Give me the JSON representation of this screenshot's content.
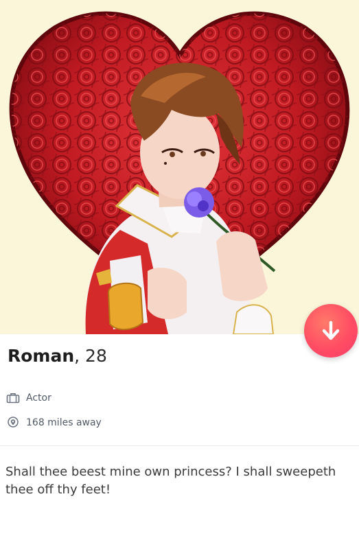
{
  "profile": {
    "name": "Roman",
    "age_text": ", 28",
    "job": "Actor",
    "distance": "168 miles away",
    "bio": "Shall thee beest mine own princess? I shall sweepeth thee off thy feet!"
  },
  "icons": {
    "down": "arrow-down-icon",
    "job": "briefcase-icon",
    "distance": "location-pin-icon"
  },
  "colors": {
    "accent": "#fd4f63",
    "photo_background": "#fbf5d9",
    "heart": "#b3121b",
    "secondary_text": "#505965"
  }
}
